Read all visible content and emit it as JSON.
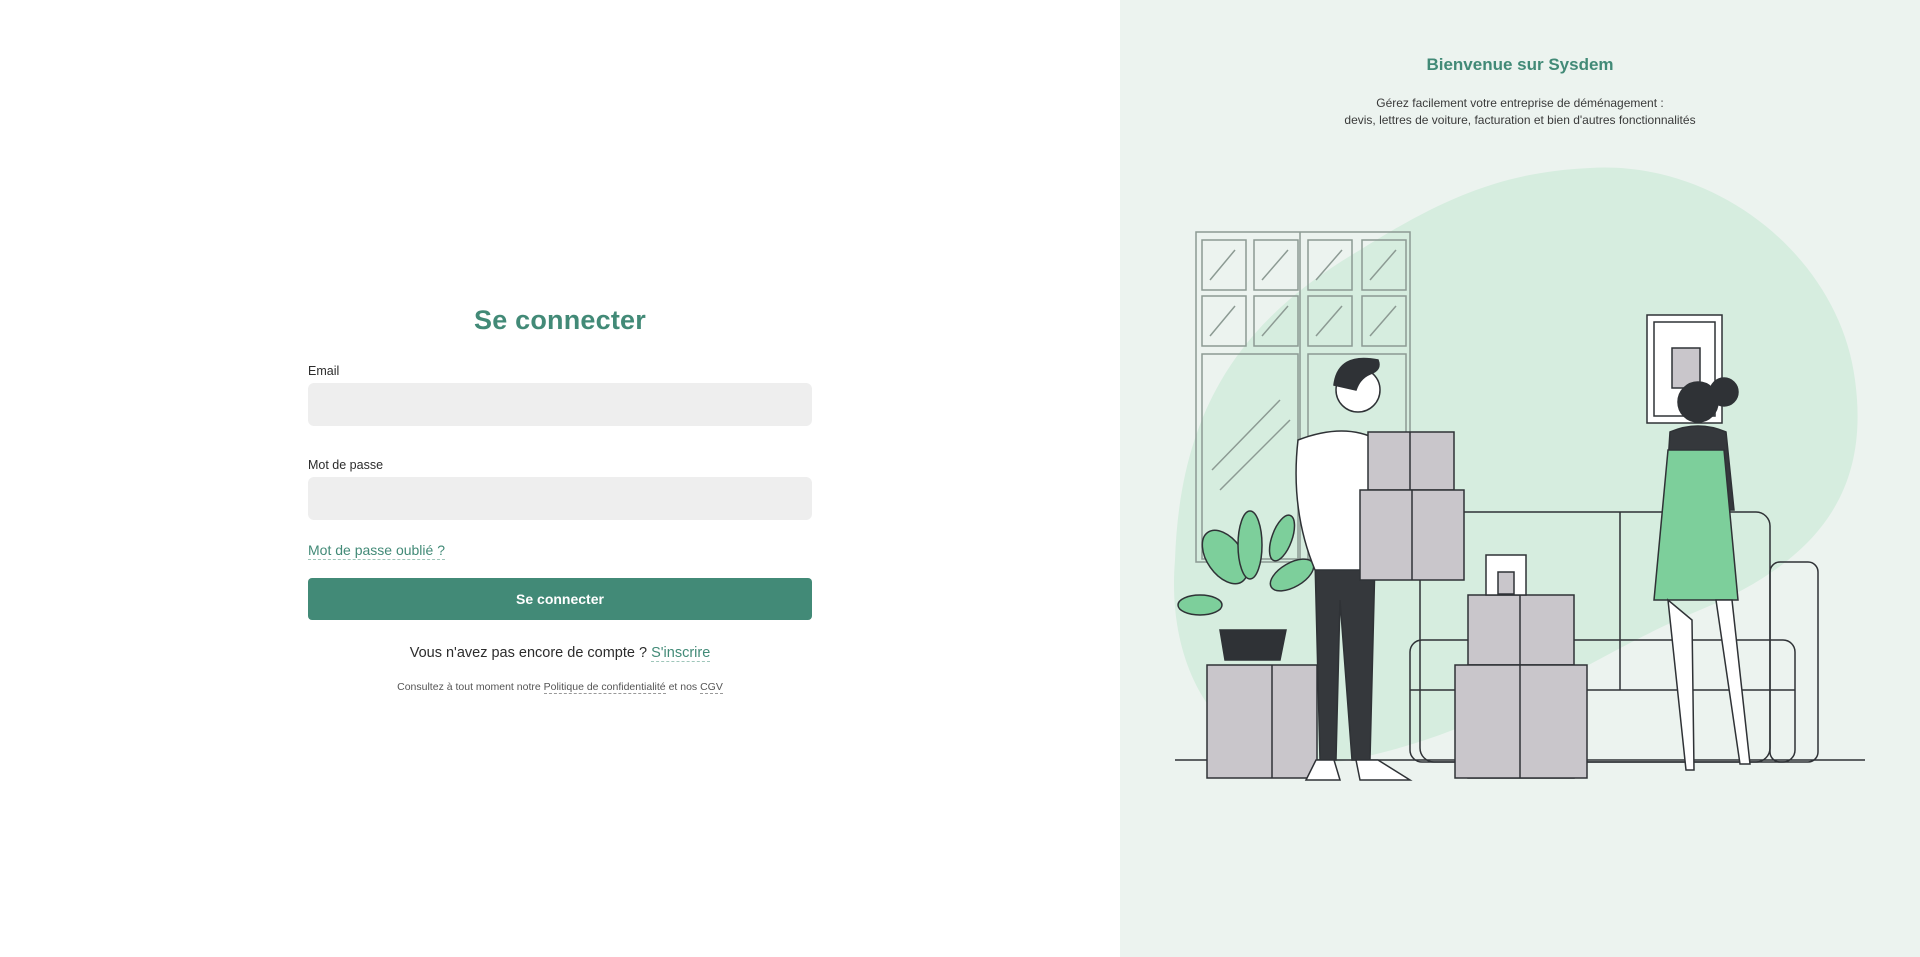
{
  "login": {
    "title": "Se connecter",
    "email_label": "Email",
    "email_value": "",
    "password_label": "Mot de passe",
    "password_value": "",
    "forgot_link": "Mot de passe oublié ?",
    "submit_label": "Se connecter",
    "no_account_text": "Vous n'avez pas encore de compte ?",
    "signup_link": "S'inscrire",
    "legal_prefix": "Consultez à tout moment notre",
    "privacy_link": "Politique de confidentialité",
    "legal_and": "et nos",
    "cgv_link": "CGV"
  },
  "promo": {
    "title": "Bienvenue sur Sysdem",
    "subtitle_line1": "Gérez facilement votre entreprise de déménagement :",
    "subtitle_line2": "devis, lettres de voiture, facturation et bien d'autres fonctionnalités",
    "illustration_icon": "moving-people-illustration"
  },
  "colors": {
    "brand": "#428a77",
    "panel_bg": "#ecf3ef",
    "input_bg": "#eeeeee",
    "blob": "#d6eddf",
    "leaf_green": "#7dcf9b",
    "box_grey": "#c9c6cb",
    "outline": "#2f3236"
  }
}
